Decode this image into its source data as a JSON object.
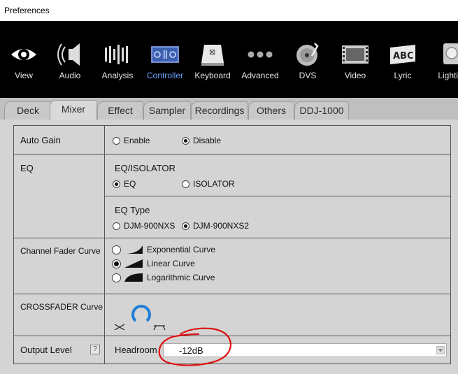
{
  "window": {
    "title": "Preferences"
  },
  "toolbar": {
    "items": [
      {
        "label": "View",
        "icon": "eye-icon"
      },
      {
        "label": "Audio",
        "icon": "speaker-icon"
      },
      {
        "label": "Analysis",
        "icon": "waveform-icon"
      },
      {
        "label": "Controller",
        "icon": "controller-icon",
        "active": true
      },
      {
        "label": "Keyboard",
        "icon": "keyboard-key-icon"
      },
      {
        "label": "Advanced",
        "icon": "dots-icon"
      },
      {
        "label": "DVS",
        "icon": "turntable-icon"
      },
      {
        "label": "Video",
        "icon": "film-icon"
      },
      {
        "label": "Lyric",
        "icon": "lyric-abc-icon"
      },
      {
        "label": "Lightin",
        "icon": "lighting-icon"
      }
    ],
    "active_color": "#6aa3ff"
  },
  "tabs": [
    {
      "label": "Deck"
    },
    {
      "label": "Mixer",
      "active": true
    },
    {
      "label": "Effect"
    },
    {
      "label": "Sampler"
    },
    {
      "label": "Recordings"
    },
    {
      "label": "Others"
    },
    {
      "label": "DDJ-1000"
    }
  ],
  "mixer": {
    "auto_gain": {
      "label": "Auto Gain",
      "options": [
        "Enable",
        "Disable"
      ],
      "selected": "Disable"
    },
    "eq": {
      "label": "EQ",
      "mode_heading": "EQ/ISOLATOR",
      "mode_options": [
        "EQ",
        "ISOLATOR"
      ],
      "mode_selected": "EQ",
      "type_heading": "EQ Type",
      "type_options": [
        "DJM-900NXS",
        "DJM-900NXS2"
      ],
      "type_selected": "DJM-900NXS2"
    },
    "channel_fader_curve": {
      "label": "Channel Fader Curve",
      "options": [
        "Exponential Curve",
        "Linear Curve",
        "Logarithmic Curve"
      ],
      "selected": "Linear Curve"
    },
    "crossfader_curve": {
      "label": "CROSSFADER Curve",
      "accent": "#1e7fd6"
    },
    "output_level": {
      "label": "Output Level",
      "help": "?",
      "field_label": "Headroom",
      "value": "-12dB"
    }
  },
  "annotation_color": "#e01010"
}
